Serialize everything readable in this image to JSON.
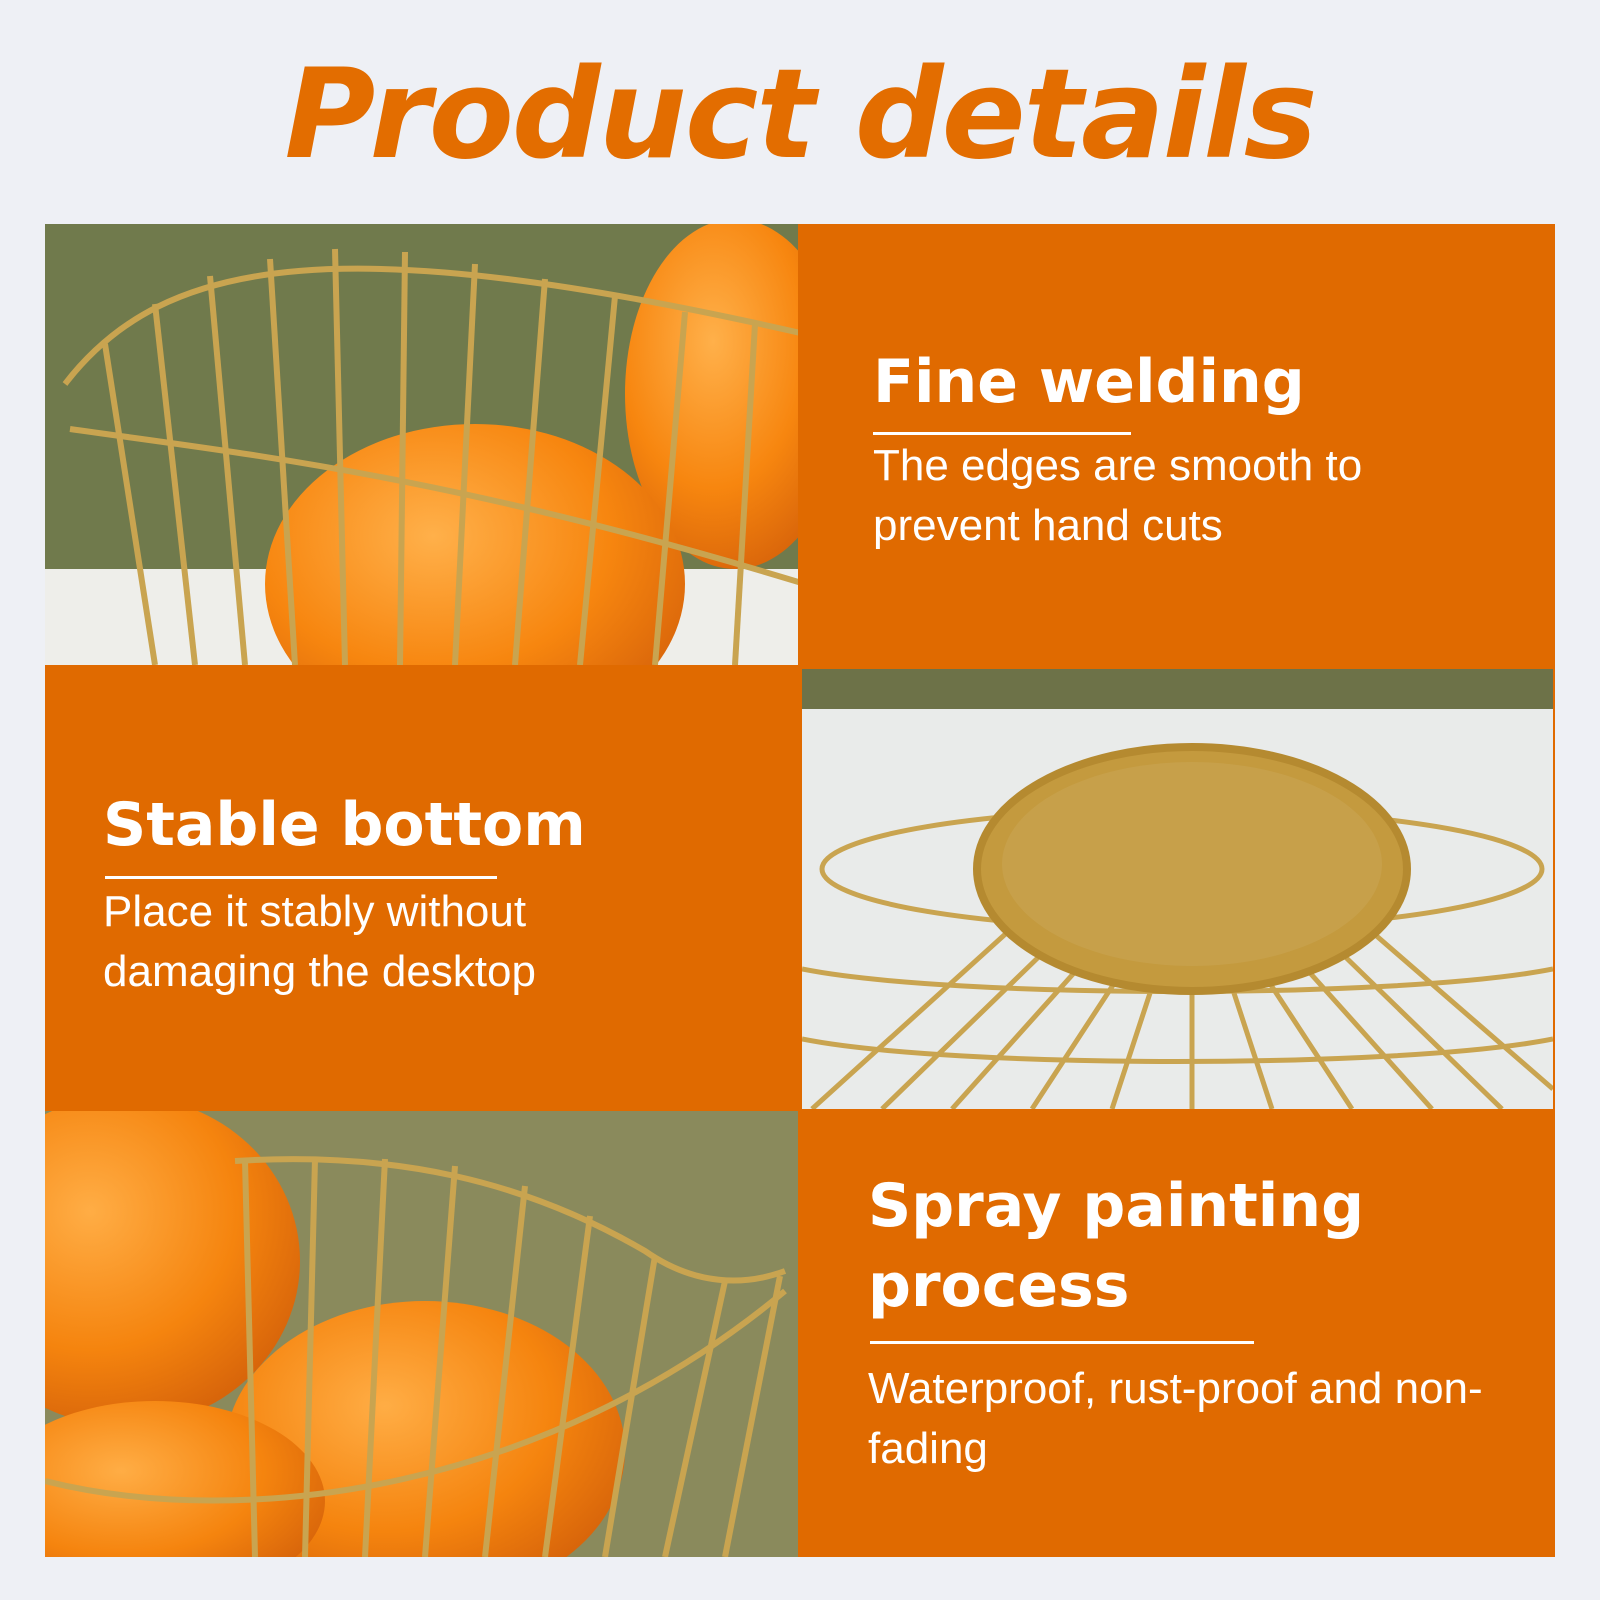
{
  "title": "Product details",
  "colors": {
    "accent": "#e06a00",
    "background": "#eef0f5",
    "text_on_accent": "#ffffff"
  },
  "features": [
    {
      "heading": "Fine welding",
      "description": "The edges are smooth to prevent hand cuts",
      "image": "gold-wire-basket-with-oranges"
    },
    {
      "heading": "Stable bottom",
      "description": "Place it stably without damaging the desktop",
      "image": "gold-wire-basket-base"
    },
    {
      "heading": "Spray painting process",
      "description": "Waterproof, rust-proof and non-fading",
      "image": "gold-wire-basket-with-oranges"
    }
  ]
}
